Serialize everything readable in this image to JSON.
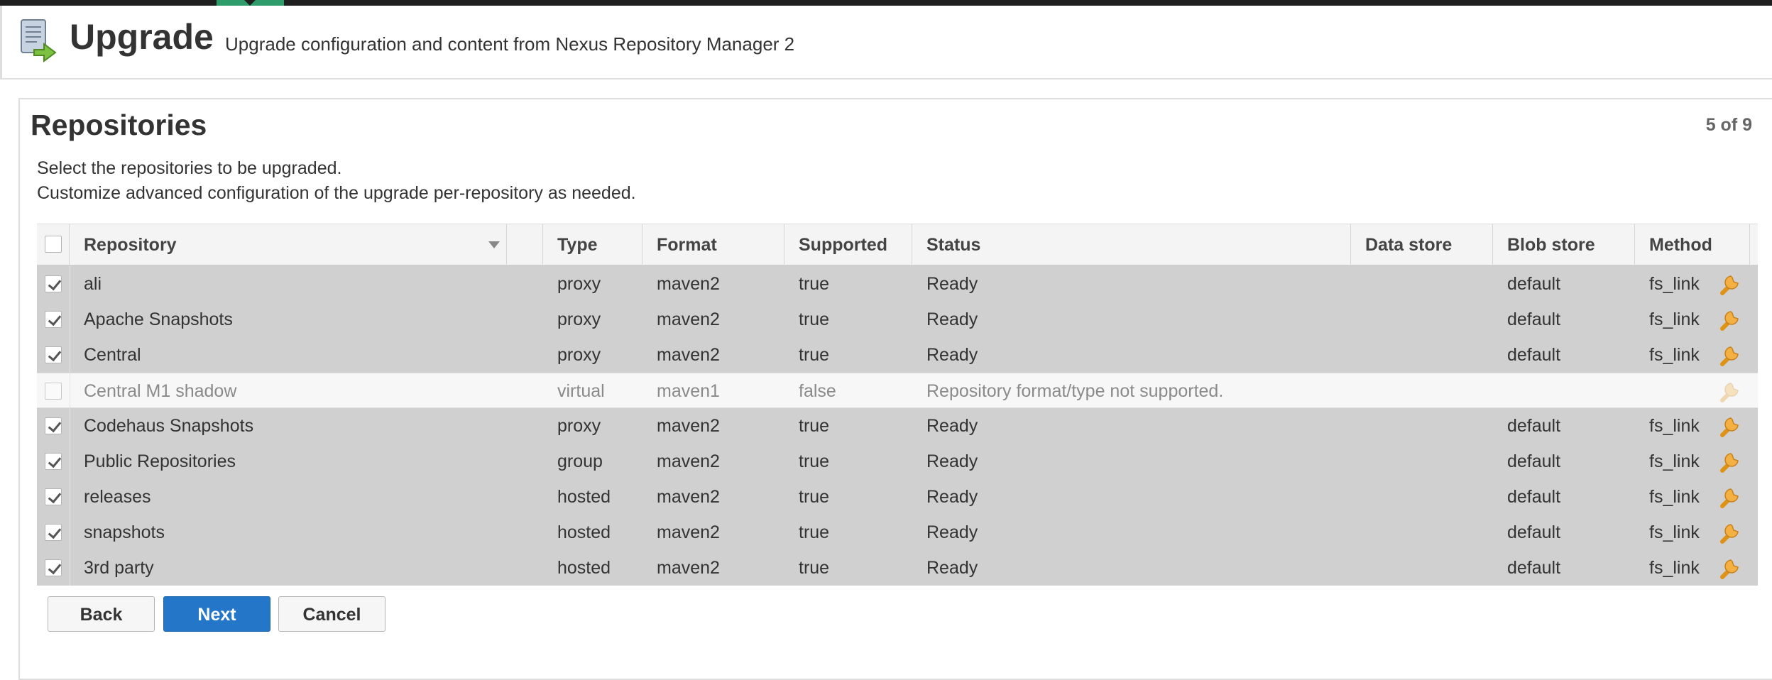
{
  "header": {
    "title": "Upgrade",
    "subtitle": "Upgrade configuration and content from Nexus Repository Manager 2"
  },
  "panel": {
    "title": "Repositories",
    "step": "5 of 9",
    "instructions": [
      "Select the repositories to be upgraded.",
      "Customize advanced configuration of the upgrade per-repository as needed."
    ]
  },
  "grid": {
    "columns": [
      "Repository",
      "Type",
      "Format",
      "Supported",
      "Status",
      "Data store",
      "Blob store",
      "Method"
    ],
    "rows": [
      {
        "repository": "ali",
        "type": "proxy",
        "format": "maven2",
        "supported": "true",
        "status": "Ready",
        "data_store": "",
        "blob_store": "default",
        "method": "fs_link",
        "checked": true
      },
      {
        "repository": "Apache Snapshots",
        "type": "proxy",
        "format": "maven2",
        "supported": "true",
        "status": "Ready",
        "data_store": "",
        "blob_store": "default",
        "method": "fs_link",
        "checked": true
      },
      {
        "repository": "Central",
        "type": "proxy",
        "format": "maven2",
        "supported": "true",
        "status": "Ready",
        "data_store": "",
        "blob_store": "default",
        "method": "fs_link",
        "checked": true
      },
      {
        "repository": "Central M1 shadow",
        "type": "virtual",
        "format": "maven1",
        "supported": "false",
        "status": "Repository format/type not supported.",
        "data_store": "",
        "blob_store": "",
        "method": "",
        "checked": false
      },
      {
        "repository": "Codehaus Snapshots",
        "type": "proxy",
        "format": "maven2",
        "supported": "true",
        "status": "Ready",
        "data_store": "",
        "blob_store": "default",
        "method": "fs_link",
        "checked": true
      },
      {
        "repository": "Public Repositories",
        "type": "group",
        "format": "maven2",
        "supported": "true",
        "status": "Ready",
        "data_store": "",
        "blob_store": "default",
        "method": "fs_link",
        "checked": true
      },
      {
        "repository": "releases",
        "type": "hosted",
        "format": "maven2",
        "supported": "true",
        "status": "Ready",
        "data_store": "",
        "blob_store": "default",
        "method": "fs_link",
        "checked": true
      },
      {
        "repository": "snapshots",
        "type": "hosted",
        "format": "maven2",
        "supported": "true",
        "status": "Ready",
        "data_store": "",
        "blob_store": "default",
        "method": "fs_link",
        "checked": true
      },
      {
        "repository": "3rd party",
        "type": "hosted",
        "format": "maven2",
        "supported": "true",
        "status": "Ready",
        "data_store": "",
        "blob_store": "default",
        "method": "fs_link",
        "checked": true
      }
    ]
  },
  "buttons": {
    "back": "Back",
    "next": "Next",
    "cancel": "Cancel"
  },
  "colors": {
    "primary": "#2476c8",
    "selected_row": "#d0d0d0",
    "wrench": "#f0a020",
    "accent": "#2f9c6b"
  },
  "icons": {
    "page": "upgrade-document-icon",
    "row_action": "wrench-icon"
  }
}
